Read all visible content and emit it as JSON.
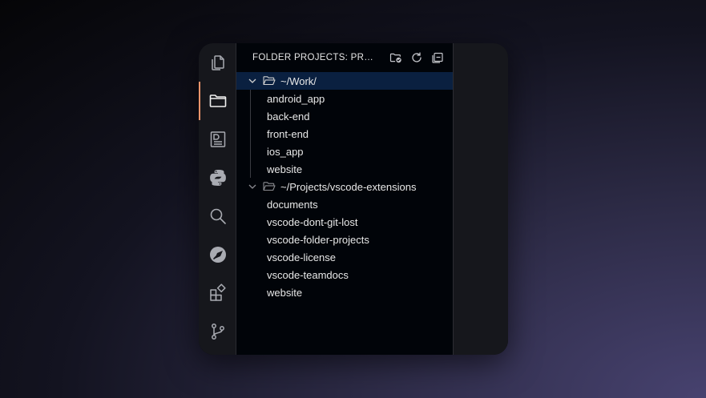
{
  "activity_bar": {
    "items": [
      {
        "name": "explorer",
        "icon": "files-icon",
        "active": false
      },
      {
        "name": "folder-projects",
        "icon": "folder-icon",
        "active": true
      },
      {
        "name": "teamdocs",
        "icon": "document-icon",
        "active": false
      },
      {
        "name": "python",
        "icon": "python-icon",
        "active": false
      },
      {
        "name": "search",
        "icon": "search-icon",
        "active": false
      },
      {
        "name": "extension",
        "icon": "rocket-icon",
        "active": false
      },
      {
        "name": "extensions",
        "icon": "extensions-icon",
        "active": false
      },
      {
        "name": "source-control",
        "icon": "git-branch-icon",
        "active": false
      }
    ],
    "accent_color": "#f2946b"
  },
  "sidebar": {
    "title": "FOLDER PROJECTS: PROJECTS",
    "actions": [
      "add-folder-icon",
      "refresh-icon",
      "collapse-all-icon"
    ]
  },
  "tree": {
    "groups": [
      {
        "label": "~/Work/",
        "selected": true,
        "children": [
          "android_app",
          "back-end",
          "front-end",
          "ios_app",
          "website"
        ]
      },
      {
        "label": "~/Projects/vscode-extensions",
        "selected": false,
        "children": [
          "documents",
          "vscode-dont-git-lost",
          "vscode-folder-projects",
          "vscode-license",
          "vscode-teamdocs",
          "website"
        ]
      }
    ]
  }
}
